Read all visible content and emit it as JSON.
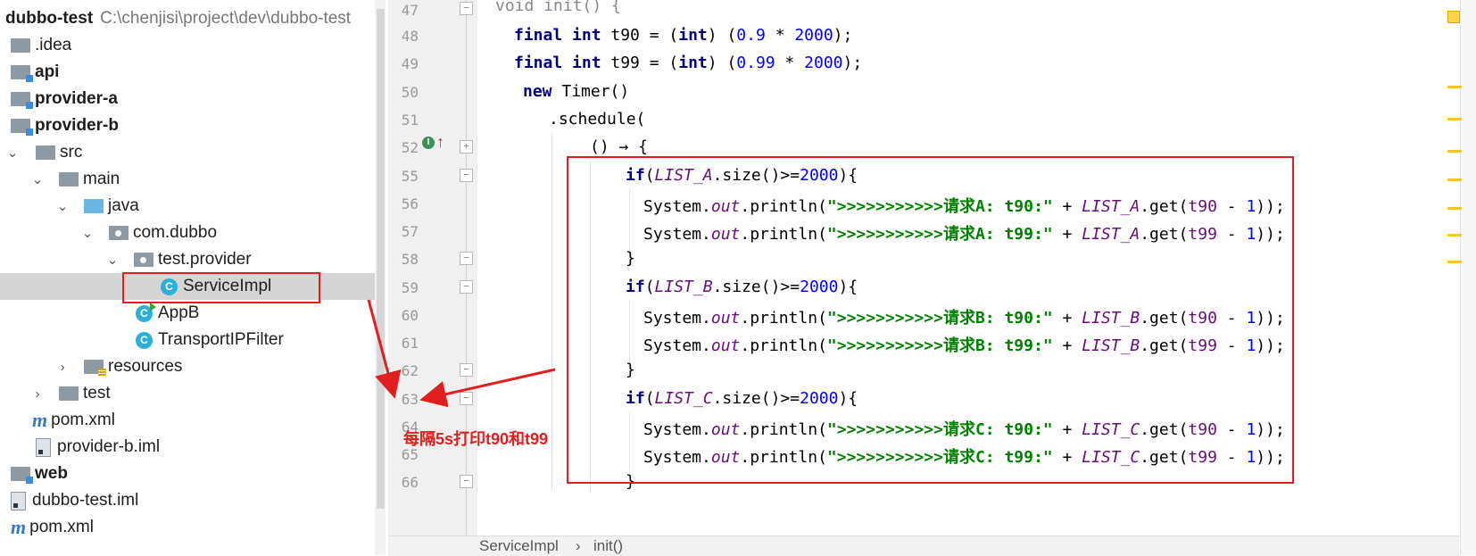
{
  "tree": {
    "root_name": "dubbo-test",
    "root_path": "C:\\chenjisi\\project\\dev\\dubbo-test",
    "items": [
      {
        "label": ".idea"
      },
      {
        "label": "api"
      },
      {
        "label": "provider-a"
      },
      {
        "label": "provider-b"
      },
      {
        "label": "src"
      },
      {
        "label": "main"
      },
      {
        "label": "java"
      },
      {
        "label": "com.dubbo"
      },
      {
        "label": "test.provider"
      },
      {
        "label": "ServiceImpl"
      },
      {
        "label": "AppB"
      },
      {
        "label": "TransportIPFilter"
      },
      {
        "label": "resources"
      },
      {
        "label": "test"
      },
      {
        "label": "pom.xml"
      },
      {
        "label": "provider-b.iml"
      },
      {
        "label": "web"
      },
      {
        "label": "dubbo-test.iml"
      },
      {
        "label": "pom.xml"
      }
    ]
  },
  "editor": {
    "line_numbers": [
      "47",
      "48",
      "49",
      "50",
      "51",
      "52",
      "55",
      "56",
      "57",
      "58",
      "59",
      "60",
      "61",
      "62",
      "63",
      "64",
      "65",
      "66"
    ],
    "code": {
      "l47": "void init() {",
      "l48_a": "final",
      "l48_b": "int",
      "l48_c": " t90 = (",
      "l48_d": "int",
      "l48_e": ") (",
      "l48_f": "0.9",
      "l48_g": " * ",
      "l48_h": "2000",
      "l48_i": ");",
      "l49_a": "final",
      "l49_b": "int",
      "l49_c": " t99 = (",
      "l49_d": "int",
      "l49_e": ") (",
      "l49_f": "0.99",
      "l49_g": " * ",
      "l49_h": "2000",
      "l49_i": ");",
      "l50_a": "new",
      "l50_b": " Timer()",
      "l51": ".schedule(",
      "l52": "() → {",
      "if_kw": "if",
      "list_a": "LIST_A",
      "list_b": "LIST_B",
      "list_c": "LIST_C",
      "size_part": ".size()>=",
      "size_num": "2000",
      "brace_open": "){",
      "sys": "System.",
      "out": "out",
      "println": ".println(",
      "str_a90": "\">>>>>>>>>>>请求A: t90:\"",
      "str_a99": "\">>>>>>>>>>>请求A: t99:\"",
      "str_b90": "\">>>>>>>>>>>请求B: t90:\"",
      "str_b99": "\">>>>>>>>>>>请求B: t99:\"",
      "str_c90": "\">>>>>>>>>>>请求C: t90:\"",
      "str_c99": "\">>>>>>>>>>>请求C: t99:\"",
      "plus": " + ",
      "get": ".get(",
      "t90": "t90",
      "t99": "t99",
      "minus": " - ",
      "one": "1",
      "close": "));",
      "brace_close": "}"
    }
  },
  "breadcrumb": {
    "items": [
      "ServiceImpl",
      "init()"
    ],
    "separator": "›"
  },
  "annotation": {
    "text": "每隔5s打印t90和t99",
    "color": "#e31e1e"
  },
  "colors": {
    "keyword": "#000080",
    "number": "#0000ff",
    "string": "#008000",
    "static_field": "#660e7a"
  }
}
